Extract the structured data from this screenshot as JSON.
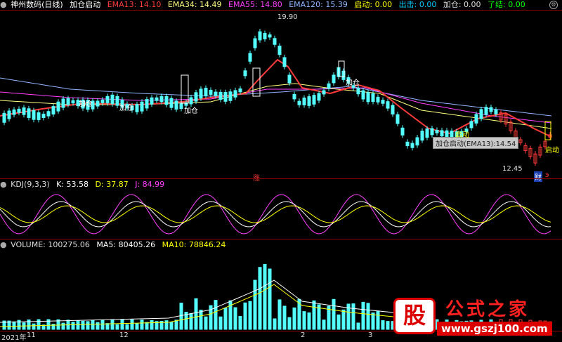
{
  "header": {
    "title": "神州数码(日线)",
    "signal_name": "加仓启动",
    "ema13": {
      "label": "EMA13:",
      "value": "14.10",
      "color": "#ff3b3b"
    },
    "ema34": {
      "label": "EMA34:",
      "value": "14.49",
      "color": "#ffff80"
    },
    "ema55": {
      "label": "EMA55:",
      "value": "14.80",
      "color": "#ff40ff"
    },
    "ema120": {
      "label": "EMA120:",
      "value": "15.39",
      "color": "#8fb4ff"
    },
    "qidong": {
      "label": "启动:",
      "value": "0.00",
      "color": "#ffff00"
    },
    "chuji": {
      "label": "出击:",
      "value": "0.00",
      "color": "#00ccff"
    },
    "jiacang": {
      "label": "加仓:",
      "value": "0.00",
      "color": "#dddddd"
    },
    "liaojie": {
      "label": "了结:",
      "value": "0.00",
      "color": "#00ff00"
    }
  },
  "annotations": {
    "high": "19.90",
    "low": "12.45",
    "tooltip": "加仓启动(EMA13):14.54",
    "zhang": "涨",
    "cai": "财",
    "e": "э",
    "jiacang": "加仓",
    "qidong": "启动"
  },
  "kdj": {
    "title": "KDJ(9,3,3)",
    "k": {
      "label": "K:",
      "value": "53.58",
      "color": "#ffffff"
    },
    "d": {
      "label": "D:",
      "value": "37.87",
      "color": "#ffff00"
    },
    "j": {
      "label": "J:",
      "value": "84.99",
      "color": "#ff40ff"
    }
  },
  "volume": {
    "title": "VOLUME:",
    "value": "100275.06",
    "ma5": {
      "label": "MA5:",
      "value": "80405.26",
      "color": "#ffffff"
    },
    "ma10": {
      "label": "MA10:",
      "value": "78846.24",
      "color": "#ffff00"
    }
  },
  "xaxis": {
    "labels": [
      "2021年",
      "11",
      "12",
      "2",
      "3"
    ]
  },
  "watermark": {
    "logo_char": "股",
    "name": "公式之家",
    "url": "www.gszj100.com"
  },
  "colors": {
    "up": "#ff3b3b",
    "down": "#54ffff",
    "border": "#8b0000"
  }
}
